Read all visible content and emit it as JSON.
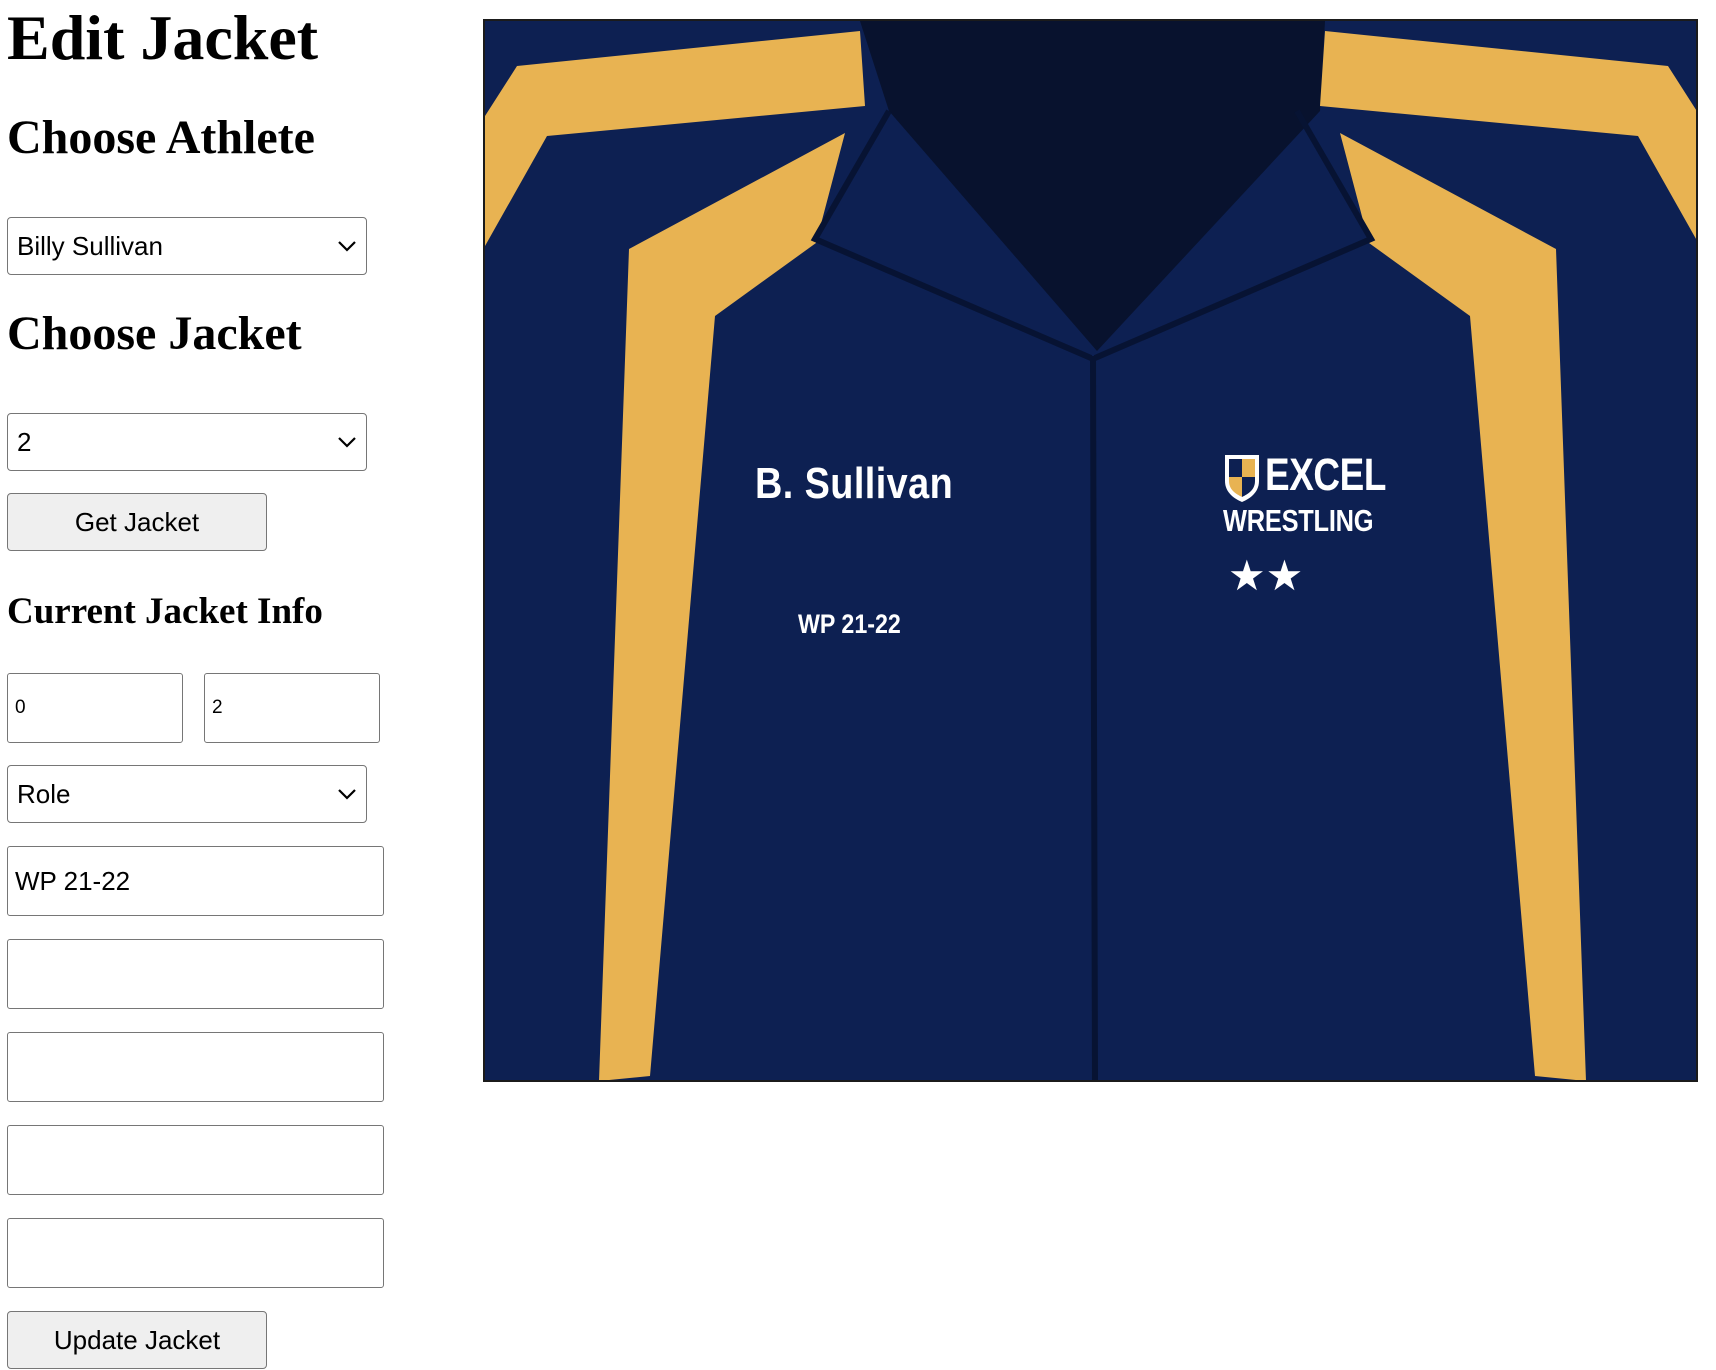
{
  "page": {
    "title": "Edit Jacket"
  },
  "athlete_section": {
    "heading": "Choose Athlete",
    "selected": "Billy Sullivan"
  },
  "jacket_section": {
    "heading": "Choose Jacket",
    "selected": "2",
    "get_button_label": "Get Jacket"
  },
  "info_section": {
    "heading": "Current Jacket Info",
    "field_a_value": "0",
    "field_b_value": "2",
    "role_selected": "Role",
    "line1_value": "WP 21-22",
    "line2_value": "",
    "line3_value": "",
    "line4_value": "",
    "line5_value": "",
    "update_button_label": "Update Jacket"
  },
  "jacket_preview": {
    "name_text": "B. Sullivan",
    "year_text": "WP 21-22",
    "logo_line1": "EXCEL",
    "logo_line2": "WRESTLING",
    "stars": "★★",
    "star_count": 2,
    "colors": {
      "body": "#0d2052",
      "collar": "#08122e",
      "stripe": "#e8b352",
      "seam": "#071333",
      "text": "#ffffff"
    }
  }
}
